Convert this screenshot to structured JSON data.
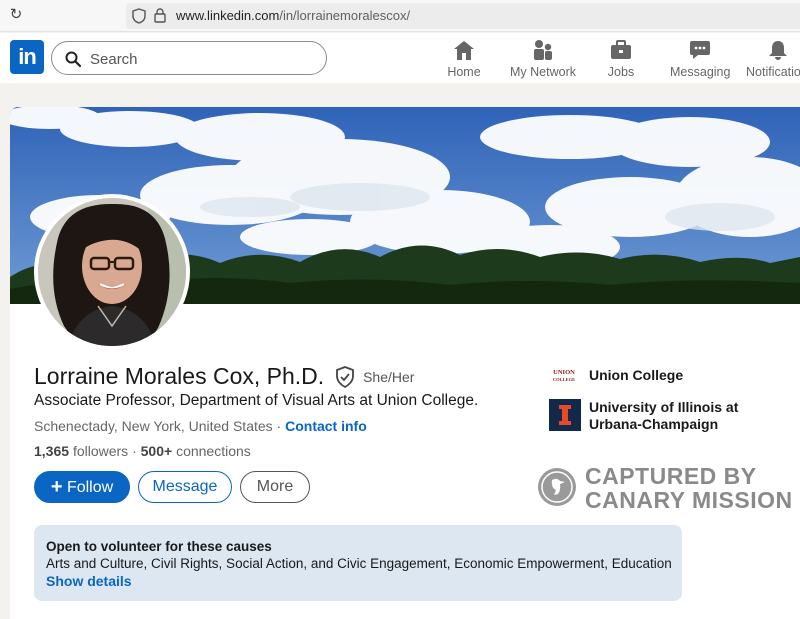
{
  "browser": {
    "url_host": "www.linkedin.com",
    "url_path": "/in/lorrainemoralescox/"
  },
  "nav": {
    "logo_text": "in",
    "search_placeholder": "Search",
    "items": [
      {
        "label": "Home",
        "icon": "home-icon"
      },
      {
        "label": "My Network",
        "icon": "network-icon"
      },
      {
        "label": "Jobs",
        "icon": "briefcase-icon"
      },
      {
        "label": "Messaging",
        "icon": "chat-icon"
      },
      {
        "label": "Notifications",
        "icon": "bell-icon"
      }
    ]
  },
  "profile": {
    "name": "Lorraine Morales Cox, Ph.D.",
    "pronouns": "She/Her",
    "headline": "Associate Professor, Department of Visual Arts at Union College.",
    "location": "Schenectady, New York, United States",
    "separator": " · ",
    "contact_label": "Contact info",
    "followers": "1,365",
    "followers_label": "followers",
    "connections": "500+",
    "connections_label": "connections",
    "follow_label": "Follow",
    "message_label": "Message",
    "more_label": "More"
  },
  "organizations": [
    {
      "name": "Union College",
      "logo_text": "UNION COLLEGE"
    },
    {
      "name_line1": "University of Illinois at",
      "name_line2": "Urbana-Champaign",
      "logo_text": "I"
    }
  ],
  "watermark": {
    "line1": "CAPTURED BY",
    "line2": "CANARY MISSION"
  },
  "volunteer": {
    "title": "Open to volunteer for these causes",
    "causes": "Arts and Culture, Civil Rights, Social Action, and Civic Engagement, Economic Empowerment, Education",
    "link": "Show details"
  },
  "colors": {
    "brand": "#0a66c2",
    "illinois_orange": "#e84a27",
    "illinois_navy": "#13294b",
    "causes_bg": "#dde7f1"
  }
}
